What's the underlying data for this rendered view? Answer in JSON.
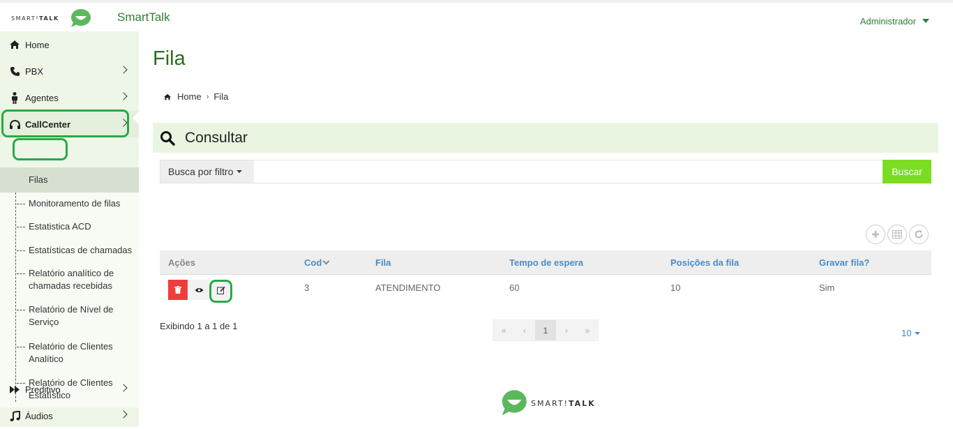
{
  "header": {
    "brand_light": "SMART!",
    "brand_bold": "TALK",
    "app_title": "SmartTalk",
    "user": "Administrador"
  },
  "sidebar": {
    "items": [
      {
        "label": "Home",
        "icon": "home-icon"
      },
      {
        "label": "PBX",
        "icon": "phone-icon"
      },
      {
        "label": "Agentes",
        "icon": "person-icon"
      },
      {
        "label": "CallCenter",
        "icon": "headset-icon"
      },
      {
        "label": "Preditivo",
        "icon": "fast-forward-icon"
      },
      {
        "label": "Áudios",
        "icon": "music-note-icon"
      }
    ],
    "callcenter_sub": [
      {
        "label": "Filas"
      },
      {
        "label": "Monitoramento de filas"
      },
      {
        "label": "Estatistica ACD"
      },
      {
        "label": "Estatísticas de chamadas"
      },
      {
        "label": "Relatório analítico de chamadas recebidas"
      },
      {
        "label": "Relatório de Nível de Serviço"
      },
      {
        "label": "Relatório de Clientes Analítico"
      },
      {
        "label": "Relatório de Clientes Estatístico"
      }
    ]
  },
  "main": {
    "page_title": "Fila",
    "breadcrumb": {
      "home": "Home",
      "current": "Fila"
    },
    "panel_title": "Consultar",
    "filter": {
      "button": "Busca por filtro",
      "placeholder": "",
      "search_button": "Buscar"
    },
    "table": {
      "columns": [
        "Ações",
        "Cod",
        "Fila",
        "Tempo de espera",
        "Posições da fila",
        "Gravar fila?"
      ],
      "rows": [
        {
          "cod": "3",
          "fila": "ATENDIMENTO",
          "tempo": "60",
          "posicoes": "10",
          "gravar": "Sim"
        }
      ]
    },
    "showing": "Exibindo 1 a 1 de 1",
    "pager": {
      "first": "«",
      "prev": "‹",
      "current": "1",
      "next": "›",
      "last": "»"
    },
    "page_size": "10"
  },
  "colors": {
    "brand_green": "#2e7d32",
    "search_green": "#7bdd21",
    "delete_red": "#f13c3c",
    "highlight": "#2aa845"
  }
}
